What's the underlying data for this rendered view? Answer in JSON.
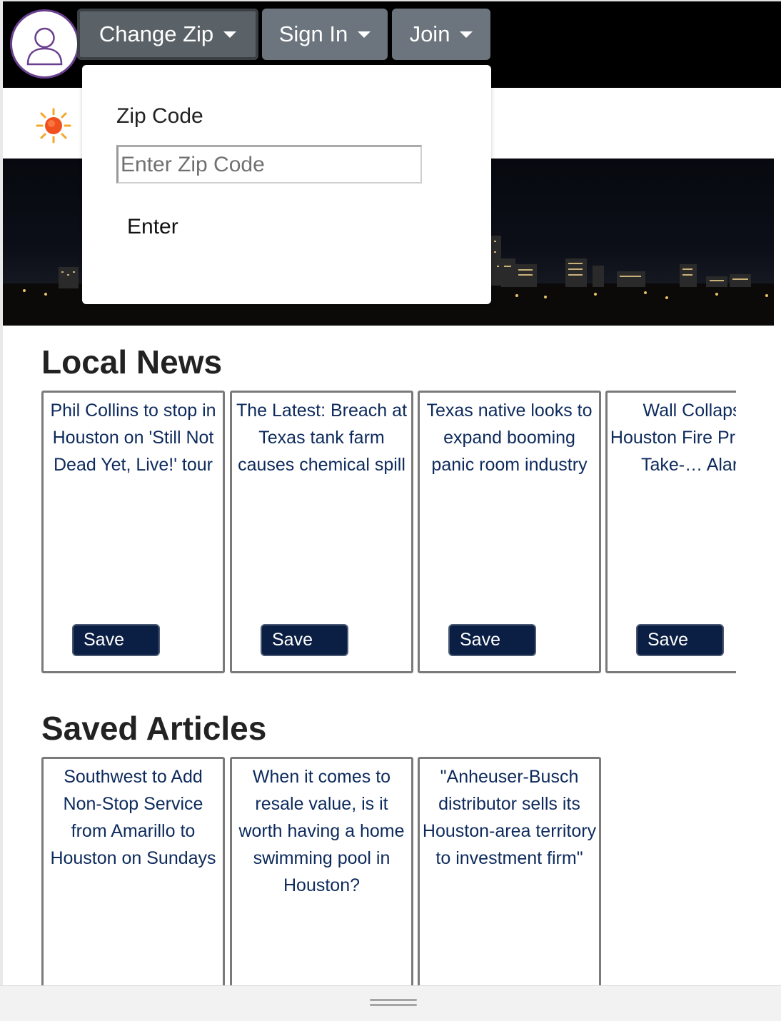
{
  "navbar": {
    "change_zip": "Change Zip",
    "sign_in": "Sign In",
    "join": "Join"
  },
  "zip_dropdown": {
    "label": "Zip Code",
    "placeholder": "Enter Zip Code",
    "enter": "Enter"
  },
  "local_news": {
    "title": "Local News",
    "articles": [
      {
        "title": "Phil Collins to stop in Houston on 'Still Not Dead Yet, Live!' tour",
        "save": "Save"
      },
      {
        "title": "The Latest: Breach at Texas tank farm causes chemical spill",
        "save": "Save"
      },
      {
        "title": "Texas native looks to expand booming panic room industry",
        "save": "Save"
      },
      {
        "title": "Wall Collapse Houston Fire Prompts Take-… Alarm",
        "save": "Save"
      }
    ]
  },
  "saved_articles": {
    "title": "Saved Articles",
    "articles": [
      {
        "title": "Southwest to Add Non-Stop Service from Amarillo to Houston on Sundays"
      },
      {
        "title": "When it comes to resale value, is it worth having a home swimming pool in Houston?"
      },
      {
        "title": "\"Anheuser-Busch distributor sells its Houston-area territory to investment firm\""
      }
    ]
  },
  "colors": {
    "navbar_bg": "#000000",
    "nav_button": "#6c757d",
    "save_button": "#0b1e43",
    "card_text": "#0d2a5c"
  },
  "icons": {
    "avatar": "user-avatar-icon",
    "weather": "sun-icon",
    "caret": "caret-down-icon",
    "handle": "drag-handle-icon"
  }
}
